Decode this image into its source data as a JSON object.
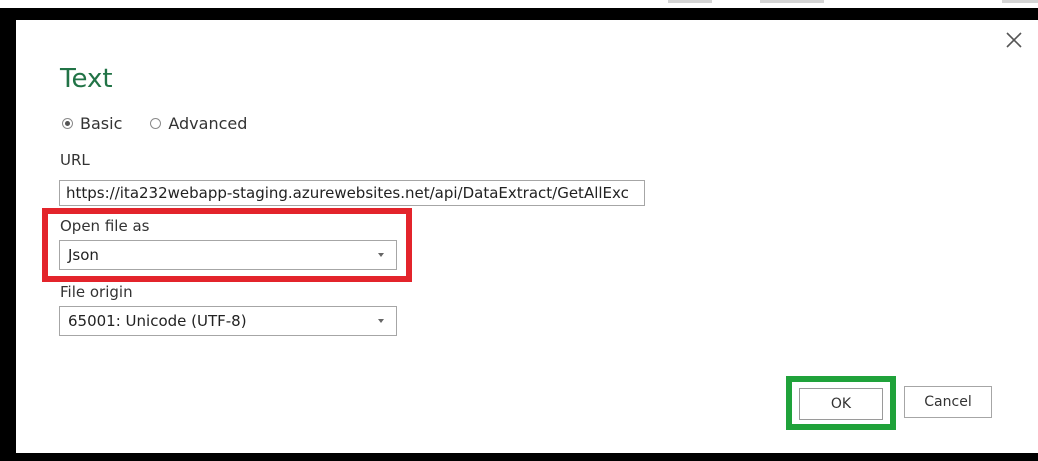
{
  "dialog": {
    "title": "Text",
    "close_icon": "close-icon",
    "mode": {
      "options": [
        {
          "label": "Basic",
          "checked": true
        },
        {
          "label": "Advanced",
          "checked": false
        }
      ]
    },
    "url": {
      "label": "URL",
      "value": "https://ita232webapp-staging.azurewebsites.net/api/DataExtract/GetAllExc"
    },
    "open_file_as": {
      "label": "Open file as",
      "selected": "Json"
    },
    "file_origin": {
      "label": "File origin",
      "selected": "65001: Unicode (UTF-8)"
    },
    "buttons": {
      "ok": "OK",
      "cancel": "Cancel"
    }
  },
  "colors": {
    "title": "#217346",
    "highlight_red": "#e3242b",
    "highlight_green": "#1fa23a",
    "frame": "#000000"
  }
}
